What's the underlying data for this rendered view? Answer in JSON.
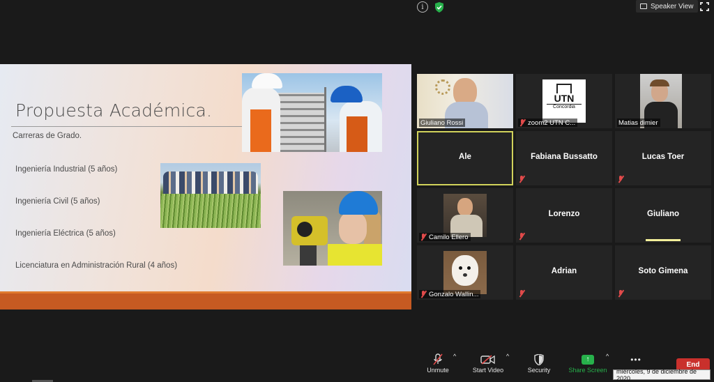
{
  "window": {
    "view_mode_label": "Speaker View",
    "info_icon": "info-icon",
    "security_icon": "shield-check-icon",
    "fullscreen_icon": "fullscreen-icon"
  },
  "slide": {
    "title": "Propuesta Académica.",
    "subtitle": "Carreras de Grado.",
    "items": [
      "Ingeniería Industrial (5 años)",
      "Ingeniería Civil (5 años)",
      "Ingeniería Eléctrica (5 años)",
      "Licenciatura en Administración Rural (4 años)"
    ]
  },
  "participants": [
    {
      "name": "Giuliano Rossi",
      "video": true,
      "muted": false
    },
    {
      "name": "zoom2 UTN C...",
      "video": true,
      "muted": true,
      "logo_text": "UTN",
      "logo_sub": "Concordia"
    },
    {
      "name": "Matias dimier",
      "video": true,
      "muted": false
    },
    {
      "name": "Ale",
      "video": false,
      "muted": false,
      "active": true
    },
    {
      "name": "Fabiana Bussatto",
      "video": false,
      "muted": true
    },
    {
      "name": "Lucas Toer",
      "video": false,
      "muted": true
    },
    {
      "name": "Camilo Ellero",
      "video": true,
      "muted": true
    },
    {
      "name": "Lorenzo",
      "video": false,
      "muted": true
    },
    {
      "name": "Giuliano",
      "video": false,
      "muted": false,
      "speaking": true
    },
    {
      "name": "Gonzalo Wallin...",
      "video": true,
      "muted": true
    },
    {
      "name": "Adrian",
      "video": false,
      "muted": true
    },
    {
      "name": "Soto Gimena",
      "video": false,
      "muted": true
    }
  ],
  "toolbar": {
    "unmute": "Unmute",
    "start_video": "Start Video",
    "security": "Security",
    "share_screen": "Share Screen",
    "more": "•••",
    "end": "End"
  },
  "tooltip": {
    "date": "miércoles, 9 de diciembre de 2020"
  },
  "colors": {
    "share_green": "#27b14b",
    "end_red": "#c9302c",
    "active_border": "#d2d35b",
    "slide_footer": "#c65a22"
  }
}
